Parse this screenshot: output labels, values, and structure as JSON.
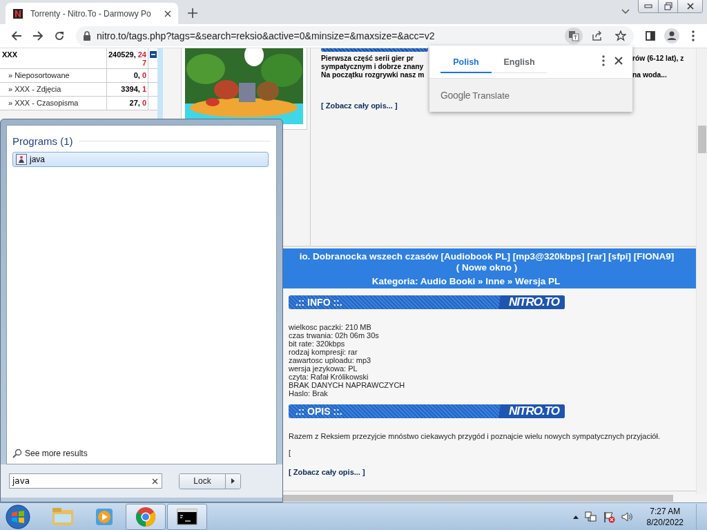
{
  "browser": {
    "tabs": [
      {
        "title": "Torrenty - Nitro.To - Darmowy Po",
        "selected": true
      }
    ],
    "url": "nitro.to/tags.php?tags=&search=reksio&active=0&minsize=&maxsize=&acc=v2"
  },
  "categories": [
    {
      "name": "XXX",
      "count": "240529,",
      "new": "247",
      "kind": "group",
      "expanded": true
    },
    {
      "name": "» Nieposortowane",
      "count": "0,",
      "new": "0",
      "kind": "item"
    },
    {
      "name": "» XXX - Zdjęcia",
      "count": "3394,",
      "new": "1",
      "kind": "item"
    },
    {
      "name": "» XXX - Czasopisma",
      "count": "27,",
      "new": "0",
      "kind": "item"
    }
  ],
  "description": {
    "lines": [
      {
        "left": "Pierwsza część serii gier pr",
        "right": "rów (6-12 lat), z"
      },
      {
        "left": "sympatycznym i dobrze znany"
      },
      {
        "left": "Na początku rozgrywki nasz m",
        "right": "na woda..."
      }
    ],
    "more_link": "[ Zobacz cały opis... ]"
  },
  "torrent": {
    "title": "io. Dobranocka wszech czasów [Audiobook PL] [mp3@320kbps] [rar] [sfpi] [FIONA9]",
    "new_window_link": "( Nowe okno )",
    "category": "Kategoria: Audio Booki » Inne » Wersja PL",
    "sections": [
      {
        "label": ".:: INFO ::.",
        "logo": "NITRO.TO",
        "kind": "list",
        "lines": [
          "wielkosc paczki: 210 MB",
          "czas trwania: 02h 06m 30s",
          "bit rate: 320kbps",
          "rodzaj kompresji: rar",
          "zawartosc uploadu: mp3",
          "wersja jezykowa: PL",
          "czyta: Rafał Królikowski",
          "BRAK DANYCH NAPRAWCZYCH",
          "Haslo: Brak"
        ]
      },
      {
        "label": ".:: OPIS ::.",
        "logo": "NITRO.TO",
        "kind": "text",
        "lines": [
          "Razem z Reksiem przezyjcie mnóstwo ciekawych przygód i poznajcie wielu nowych sympatycznych przyjaciół.",
          "["
        ],
        "more_link": "[ Zobacz cały opis... ]"
      }
    ]
  },
  "translate_popup": {
    "tabs": [
      {
        "label": "Polish",
        "selected": true
      },
      {
        "label": "English",
        "selected": false
      }
    ],
    "brand": "Google",
    "product": "Translate"
  },
  "start_menu": {
    "section": "Programs (1)",
    "results": [
      {
        "label": "java",
        "selected": true
      }
    ],
    "see_more": "See more results",
    "search": {
      "value": "java"
    },
    "power_button": "Lock"
  },
  "taskbar": {
    "apps": [
      {
        "kind": "explorer",
        "active": false
      },
      {
        "kind": "media",
        "active": false
      },
      {
        "kind": "chrome",
        "active": true
      },
      {
        "kind": "cmd",
        "active": true
      }
    ],
    "time": "7:27 AM",
    "date": "8/20/2022"
  }
}
